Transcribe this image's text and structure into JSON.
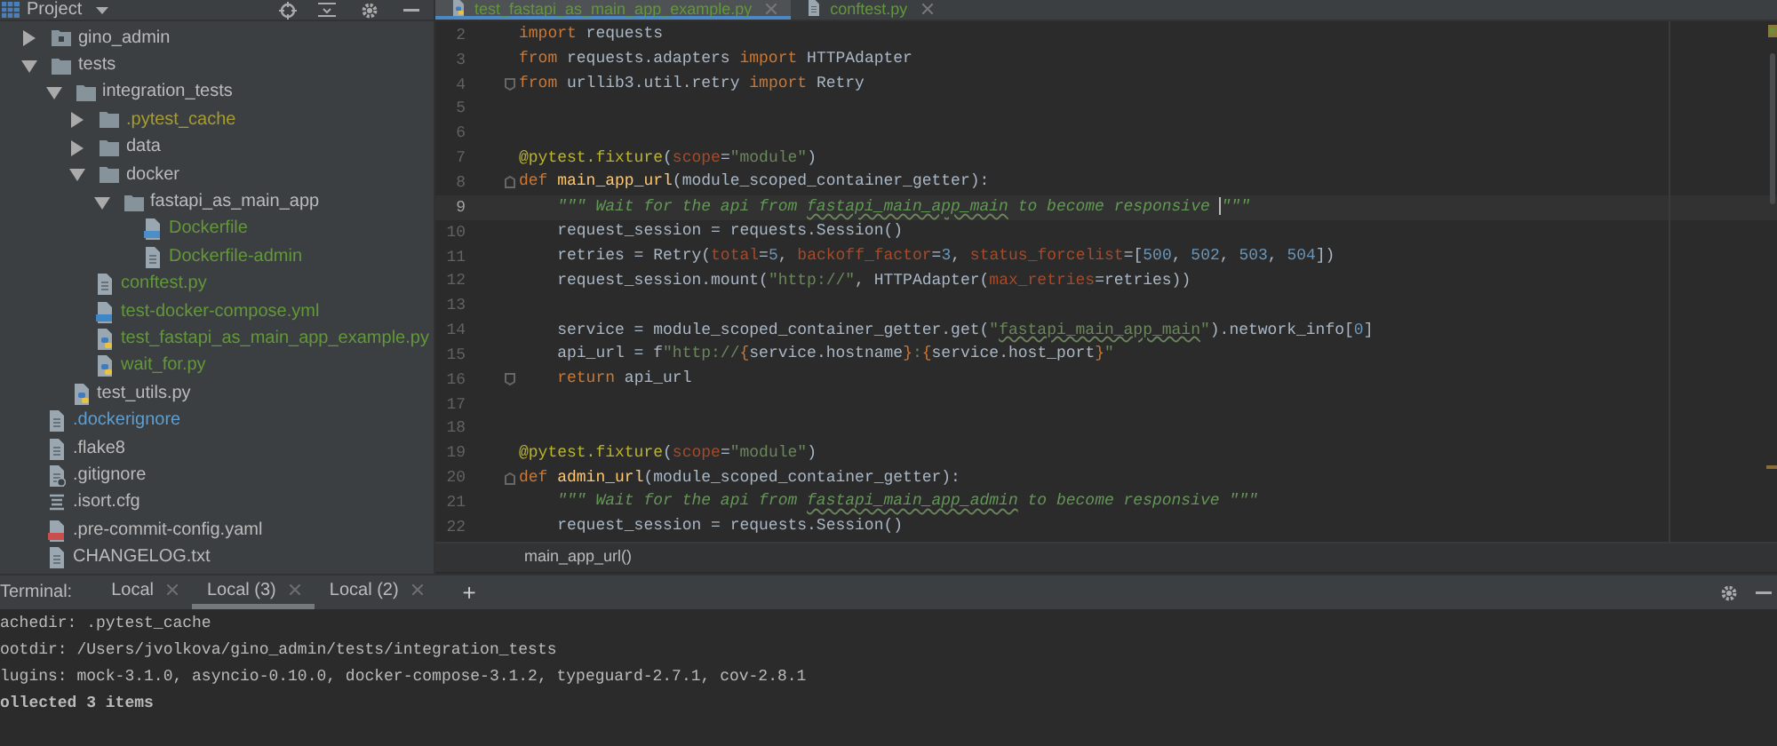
{
  "project_panel": {
    "title": "Project",
    "tree": [
      {
        "name": "gino_admin",
        "kind": "module",
        "color": "#bbbbbb",
        "expanded": false
      },
      {
        "name": "tests",
        "kind": "folder",
        "color": "#bbbbbb",
        "expanded": true,
        "children": [
          {
            "name": "integration_tests",
            "kind": "folder",
            "color": "#bbbbbb",
            "expanded": true,
            "children": [
              {
                "name": ".pytest_cache",
                "kind": "folder",
                "color": "#a79d2e",
                "expanded": false
              },
              {
                "name": "data",
                "kind": "folder",
                "color": "#bbbbbb",
                "expanded": false
              },
              {
                "name": "docker",
                "kind": "folder",
                "color": "#bbbbbb",
                "expanded": true,
                "children": [
                  {
                    "name": "fastapi_as_main_app",
                    "kind": "folder",
                    "color": "#bbbbbb",
                    "expanded": true,
                    "children": [
                      {
                        "name": "Dockerfile",
                        "kind": "dockerfile",
                        "color": "#62973a"
                      },
                      {
                        "name": "Dockerfile-admin",
                        "kind": "file",
                        "color": "#62973a"
                      }
                    ]
                  }
                ]
              },
              {
                "name": "conftest.py",
                "kind": "file",
                "color": "#62973a"
              },
              {
                "name": "test-docker-compose.yml",
                "kind": "compose",
                "color": "#62973a"
              },
              {
                "name": "test_fastapi_as_main_app_example.py",
                "kind": "python",
                "color": "#62973a"
              },
              {
                "name": "wait_for.py",
                "kind": "python",
                "color": "#62973a"
              }
            ]
          },
          {
            "name": "test_utils.py",
            "kind": "python",
            "color": "#bbbbbb"
          }
        ]
      },
      {
        "name": ".dockerignore",
        "kind": "file",
        "color": "#5d9fd2"
      },
      {
        "name": ".flake8",
        "kind": "file",
        "color": "#bbbbbb"
      },
      {
        "name": ".gitignore",
        "kind": "gitignore",
        "color": "#bbbbbb"
      },
      {
        "name": ".isort.cfg",
        "kind": "config",
        "color": "#bbbbbb"
      },
      {
        "name": ".pre-commit-config.yaml",
        "kind": "yaml",
        "color": "#bbbbbb"
      },
      {
        "name": "CHANGELOG.txt",
        "kind": "file",
        "color": "#bbbbbb"
      }
    ]
  },
  "editor": {
    "tabs": [
      {
        "label": "test_fastapi_as_main_app_example.py",
        "kind": "python",
        "selected": true
      },
      {
        "label": "conftest.py",
        "kind": "file",
        "selected": false
      }
    ],
    "lines": [
      {
        "number": "2",
        "current": false,
        "tokens": [
          {
            "text": "import",
            "kind": "keyword"
          },
          {
            "text": " requests",
            "kind": "plain"
          }
        ]
      },
      {
        "number": "3",
        "current": false,
        "tokens": [
          {
            "text": "from",
            "kind": "keyword"
          },
          {
            "text": " requests.adapters ",
            "kind": "plain"
          },
          {
            "text": "import",
            "kind": "keyword"
          },
          {
            "text": " HTTPAdapter",
            "kind": "plain"
          }
        ]
      },
      {
        "number": "4",
        "current": false,
        "fold_end": true,
        "tokens": [
          {
            "text": "from",
            "kind": "keyword"
          },
          {
            "text": " urllib3.util.retry ",
            "kind": "plain"
          },
          {
            "text": "import",
            "kind": "keyword"
          },
          {
            "text": " Retry",
            "kind": "plain"
          }
        ]
      },
      {
        "number": "5",
        "current": false
      },
      {
        "number": "6",
        "current": false
      },
      {
        "number": "7",
        "current": false,
        "tokens": [
          {
            "text": "@pytest.fixture",
            "kind": "decorator"
          },
          {
            "text": "(",
            "kind": "plain"
          },
          {
            "text": "scope",
            "kind": "param"
          },
          {
            "text": "=",
            "kind": "plain"
          },
          {
            "text": "\"module\"",
            "kind": "string"
          },
          {
            "text": ")",
            "kind": "plain"
          }
        ]
      },
      {
        "number": "8",
        "current": false,
        "fold_start": true,
        "tokens": [
          {
            "text": "def ",
            "kind": "keyword"
          },
          {
            "text": "main_app_url",
            "kind": "function"
          },
          {
            "text": "(module_scoped_container_getter):",
            "kind": "plain"
          }
        ]
      },
      {
        "number": "9",
        "current": true,
        "tokens": [
          {
            "text": "    \"\"\" Wait for the api from ",
            "kind": "docstring"
          },
          {
            "text": "fastapi_main_app_main",
            "kind": "docstring",
            "typo": true
          },
          {
            "text": " to become responsive ",
            "kind": "docstring"
          },
          {
            "text": "\"\"\"",
            "kind": "docstring",
            "caret_before": true
          }
        ]
      },
      {
        "number": "10",
        "current": false,
        "tokens": [
          {
            "text": "    request_session = requests.Session()",
            "kind": "plain"
          }
        ]
      },
      {
        "number": "11",
        "current": false,
        "tokens": [
          {
            "text": "    retries = Retry(",
            "kind": "plain"
          },
          {
            "text": "total",
            "kind": "param"
          },
          {
            "text": "=",
            "kind": "plain"
          },
          {
            "text": "5",
            "kind": "number"
          },
          {
            "text": ", ",
            "kind": "plain"
          },
          {
            "text": "backoff_factor",
            "kind": "param"
          },
          {
            "text": "=",
            "kind": "plain"
          },
          {
            "text": "3",
            "kind": "number"
          },
          {
            "text": ", ",
            "kind": "plain"
          },
          {
            "text": "status_forcelist",
            "kind": "param"
          },
          {
            "text": "=[",
            "kind": "plain"
          },
          {
            "text": "500",
            "kind": "number"
          },
          {
            "text": ", ",
            "kind": "plain"
          },
          {
            "text": "502",
            "kind": "number"
          },
          {
            "text": ", ",
            "kind": "plain"
          },
          {
            "text": "503",
            "kind": "number"
          },
          {
            "text": ", ",
            "kind": "plain"
          },
          {
            "text": "504",
            "kind": "number"
          },
          {
            "text": "])",
            "kind": "plain"
          }
        ]
      },
      {
        "number": "12",
        "current": false,
        "tokens": [
          {
            "text": "    request_session.mount(",
            "kind": "plain"
          },
          {
            "text": "\"http://\"",
            "kind": "string"
          },
          {
            "text": ", HTTPAdapter(",
            "kind": "plain"
          },
          {
            "text": "max_retries",
            "kind": "param"
          },
          {
            "text": "=retries))",
            "kind": "plain"
          }
        ]
      },
      {
        "number": "13",
        "current": false
      },
      {
        "number": "14",
        "current": false,
        "tokens": [
          {
            "text": "    service = module_scoped_container_getter.get(",
            "kind": "plain"
          },
          {
            "text": "\"",
            "kind": "string"
          },
          {
            "text": "fastapi_main_app_main",
            "kind": "string",
            "typo": true
          },
          {
            "text": "\"",
            "kind": "string"
          },
          {
            "text": ").network_info[",
            "kind": "plain"
          },
          {
            "text": "0",
            "kind": "number"
          },
          {
            "text": "]",
            "kind": "plain"
          }
        ]
      },
      {
        "number": "15",
        "current": false,
        "tokens": [
          {
            "text": "    api_url = f",
            "kind": "plain"
          },
          {
            "text": "\"http://",
            "kind": "string"
          },
          {
            "text": "{",
            "kind": "keyword"
          },
          {
            "text": "service.hostname",
            "kind": "plain"
          },
          {
            "text": "}",
            "kind": "keyword"
          },
          {
            "text": ":",
            "kind": "string"
          },
          {
            "text": "{",
            "kind": "keyword"
          },
          {
            "text": "service.host_port",
            "kind": "plain"
          },
          {
            "text": "}",
            "kind": "keyword"
          },
          {
            "text": "\"",
            "kind": "string"
          }
        ]
      },
      {
        "number": "16",
        "current": false,
        "fold_end": true,
        "tokens": [
          {
            "text": "    return",
            "kind": "keyword"
          },
          {
            "text": " api_url",
            "kind": "plain"
          }
        ]
      },
      {
        "number": "17",
        "current": false
      },
      {
        "number": "18",
        "current": false
      },
      {
        "number": "19",
        "current": false,
        "tokens": [
          {
            "text": "@pytest.fixture",
            "kind": "decorator"
          },
          {
            "text": "(",
            "kind": "plain"
          },
          {
            "text": "scope",
            "kind": "param"
          },
          {
            "text": "=",
            "kind": "plain"
          },
          {
            "text": "\"module\"",
            "kind": "string"
          },
          {
            "text": ")",
            "kind": "plain"
          }
        ]
      },
      {
        "number": "20",
        "current": false,
        "fold_start": true,
        "tokens": [
          {
            "text": "def ",
            "kind": "keyword"
          },
          {
            "text": "admin_url",
            "kind": "function"
          },
          {
            "text": "(module_scoped_container_getter):",
            "kind": "plain"
          }
        ]
      },
      {
        "number": "21",
        "current": false,
        "tokens": [
          {
            "text": "    \"\"\" Wait for the api from ",
            "kind": "docstring"
          },
          {
            "text": "fastapi_main_app_admin",
            "kind": "docstring",
            "typo": true
          },
          {
            "text": " to become responsive \"\"\"",
            "kind": "docstring"
          }
        ]
      },
      {
        "number": "22",
        "current": false,
        "tokens": [
          {
            "text": "    request_session = requests.Session()",
            "kind": "plain"
          }
        ]
      }
    ],
    "breadcrumb": "main_app_url()"
  },
  "terminal": {
    "title": "Terminal:",
    "tabs": [
      {
        "label": "Local",
        "selected": false
      },
      {
        "label": "Local (3)",
        "selected": true
      },
      {
        "label": "Local (2)",
        "selected": false
      }
    ],
    "add_button": "+",
    "lines": [
      {
        "text": "achedir: .pytest_cache",
        "bold": false
      },
      {
        "text": "ootdir: /Users/jvolkova/gino_admin/tests/integration_tests",
        "bold": false
      },
      {
        "text": "lugins: mock-3.1.0, asyncio-0.10.0, docker-compose-3.1.2, typeguard-2.7.1, cov-2.8.1",
        "bold": false
      },
      {
        "text": "ollected 3 items",
        "bold": true
      }
    ]
  }
}
